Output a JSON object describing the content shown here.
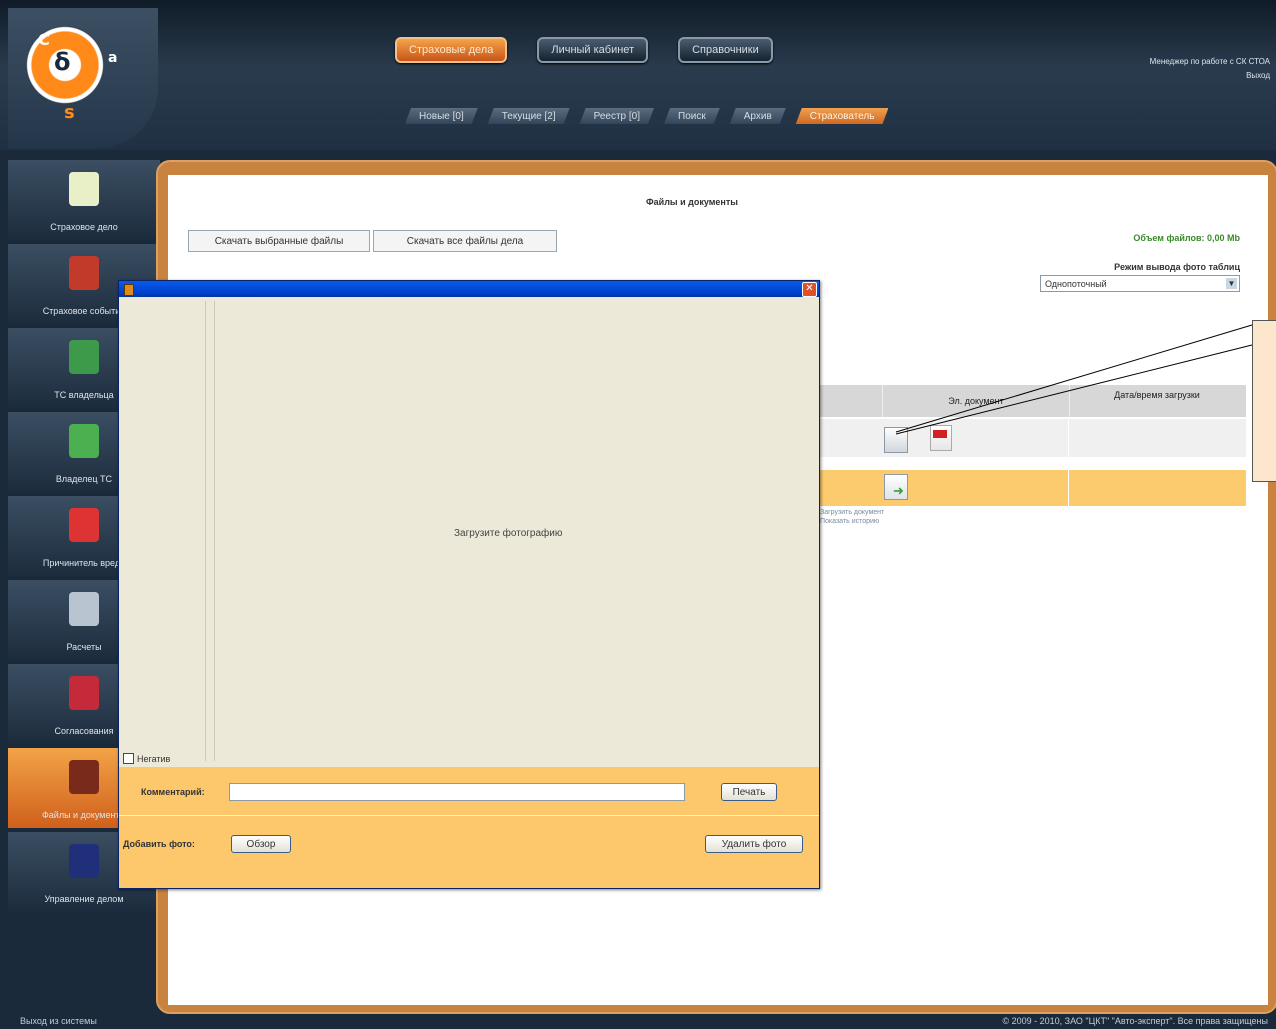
{
  "main_nav": [
    "Страховые дела",
    "Личный кабинет",
    "Справочники"
  ],
  "main_nav_active": 0,
  "status": {
    "line1": "Менеджер по работе с СК СТОА",
    "line2": "Выход"
  },
  "sub_nav": [
    "Новые [0]",
    "Текущие [2]",
    "Реестр [0]",
    "Поиск",
    "Архив",
    "Страхователь"
  ],
  "sub_nav_active": 5,
  "sidebar": [
    {
      "label": "Страховое дело",
      "icon": "clipboard-icon",
      "color": "#e9f0c8"
    },
    {
      "label": "Страховое событие",
      "icon": "cars-crash-icon",
      "color": "#c23a2a"
    },
    {
      "label": "ТС владельца",
      "icon": "car-icon",
      "color": "#3c9a4a"
    },
    {
      "label": "Владелец ТС",
      "icon": "person-green-icon",
      "color": "#4caf50"
    },
    {
      "label": "Причинитель вреда",
      "icon": "person-red-icon",
      "color": "#d33"
    },
    {
      "label": "Расчеты",
      "icon": "calculator-icon",
      "color": "#b8c4d0"
    },
    {
      "label": "Согласования",
      "icon": "stamp-icon",
      "color": "#c42a3a"
    },
    {
      "label": "Файлы и документы",
      "icon": "briefcase-icon",
      "color": "#7a2a1a"
    },
    {
      "label": "Управление делом",
      "icon": "manage-icon",
      "color": "#1f2f7a"
    }
  ],
  "sidebar_active": 7,
  "panel": {
    "title": "Файлы и документы",
    "btn_selected": "Скачать выбранные файлы",
    "btn_all": "Скачать все файлы дела",
    "volume": "Объем файлов: 0,00 Mb",
    "mode_label": "Режим вывода фото таблиц",
    "mode_value": "Однопоточный",
    "col_doc": "Эл. документ",
    "col_date": "Дата/время загрузки",
    "links_line1": "Загрузить документ",
    "links_line2": "Показать историю"
  },
  "dialog": {
    "placeholder": "Загрузите фотографию",
    "inverse_label": "Негатив",
    "comment_label": "Комментарий:",
    "comment_value": "",
    "print_btn": "Печать",
    "add_photo_label": "Добавить фото:",
    "browse_btn": "Обзор",
    "delete_btn": "Удалить фото",
    "close_glyph": "✕"
  },
  "footer": {
    "left": "Выход из системы",
    "right": "© 2009 - 2010, ЗАО \"ЦКТ\" \"Авто-эксперт\". Все права защищены"
  },
  "colors": {
    "accent": "#e47a2a",
    "title_bar": "#0a5ae8",
    "band": "#fcc86b",
    "volume": "#3a8a2a"
  }
}
